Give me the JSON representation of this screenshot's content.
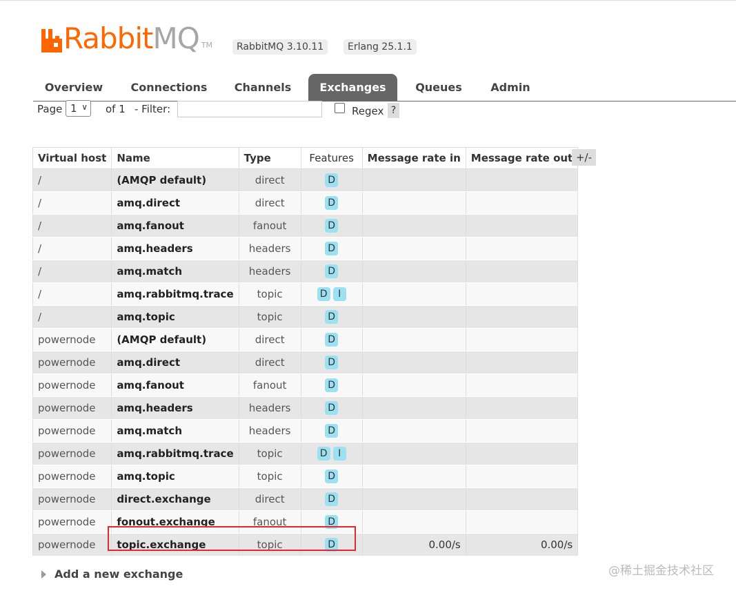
{
  "brand": {
    "logo_rabbit": "Rabbit",
    "logo_mq": "MQ",
    "logo_tm": "TM",
    "version_label": "RabbitMQ 3.10.11",
    "erlang_label": "Erlang 25.1.1",
    "brand_color": "#ff6600"
  },
  "tabs": [
    {
      "label": "Overview"
    },
    {
      "label": "Connections"
    },
    {
      "label": "Channels"
    },
    {
      "label": "Exchanges",
      "active": true
    },
    {
      "label": "Queues"
    },
    {
      "label": "Admin"
    }
  ],
  "pager": {
    "page_label": "Page",
    "page_value": "1",
    "of_label": "of 1",
    "filter_label": "- Filter:",
    "filter_value": "",
    "regex_label": "Regex",
    "regex_checked": false,
    "help_label": "?"
  },
  "table": {
    "headers": {
      "vhost": "Virtual host",
      "name": "Name",
      "type": "Type",
      "features": "Features",
      "rate_in": "Message rate in",
      "rate_out": "Message rate out"
    },
    "columns_toggle": "+/-",
    "rows": [
      {
        "vhost": "/",
        "name": "(AMQP default)",
        "type": "direct",
        "f1": "D",
        "f2": "",
        "rate_in": "",
        "rate_out": ""
      },
      {
        "vhost": "/",
        "name": "amq.direct",
        "type": "direct",
        "f1": "D",
        "f2": "",
        "rate_in": "",
        "rate_out": ""
      },
      {
        "vhost": "/",
        "name": "amq.fanout",
        "type": "fanout",
        "f1": "D",
        "f2": "",
        "rate_in": "",
        "rate_out": ""
      },
      {
        "vhost": "/",
        "name": "amq.headers",
        "type": "headers",
        "f1": "D",
        "f2": "",
        "rate_in": "",
        "rate_out": ""
      },
      {
        "vhost": "/",
        "name": "amq.match",
        "type": "headers",
        "f1": "D",
        "f2": "",
        "rate_in": "",
        "rate_out": ""
      },
      {
        "vhost": "/",
        "name": "amq.rabbitmq.trace",
        "type": "topic",
        "f1": "D",
        "f2": "I",
        "rate_in": "",
        "rate_out": ""
      },
      {
        "vhost": "/",
        "name": "amq.topic",
        "type": "topic",
        "f1": "D",
        "f2": "",
        "rate_in": "",
        "rate_out": ""
      },
      {
        "vhost": "powernode",
        "name": "(AMQP default)",
        "type": "direct",
        "f1": "D",
        "f2": "",
        "rate_in": "",
        "rate_out": ""
      },
      {
        "vhost": "powernode",
        "name": "amq.direct",
        "type": "direct",
        "f1": "D",
        "f2": "",
        "rate_in": "",
        "rate_out": ""
      },
      {
        "vhost": "powernode",
        "name": "amq.fanout",
        "type": "fanout",
        "f1": "D",
        "f2": "",
        "rate_in": "",
        "rate_out": ""
      },
      {
        "vhost": "powernode",
        "name": "amq.headers",
        "type": "headers",
        "f1": "D",
        "f2": "",
        "rate_in": "",
        "rate_out": ""
      },
      {
        "vhost": "powernode",
        "name": "amq.match",
        "type": "headers",
        "f1": "D",
        "f2": "",
        "rate_in": "",
        "rate_out": ""
      },
      {
        "vhost": "powernode",
        "name": "amq.rabbitmq.trace",
        "type": "topic",
        "f1": "D",
        "f2": "I",
        "rate_in": "",
        "rate_out": ""
      },
      {
        "vhost": "powernode",
        "name": "amq.topic",
        "type": "topic",
        "f1": "D",
        "f2": "",
        "rate_in": "",
        "rate_out": ""
      },
      {
        "vhost": "powernode",
        "name": "direct.exchange",
        "type": "direct",
        "f1": "D",
        "f2": "",
        "rate_in": "",
        "rate_out": ""
      },
      {
        "vhost": "powernode",
        "name": "fonout.exchange",
        "type": "fanout",
        "f1": "D",
        "f2": "",
        "rate_in": "",
        "rate_out": ""
      },
      {
        "vhost": "powernode",
        "name": "topic.exchange",
        "type": "topic",
        "f1": "D",
        "f2": "",
        "rate_in": "0.00/s",
        "rate_out": "0.00/s"
      }
    ]
  },
  "add_new_label": "Add a new exchange",
  "watermark": "@稀土掘金技术社区",
  "colors": {
    "badge": "#9ce1f1",
    "highlight": "#e0292f",
    "active_tab": "#666666"
  }
}
